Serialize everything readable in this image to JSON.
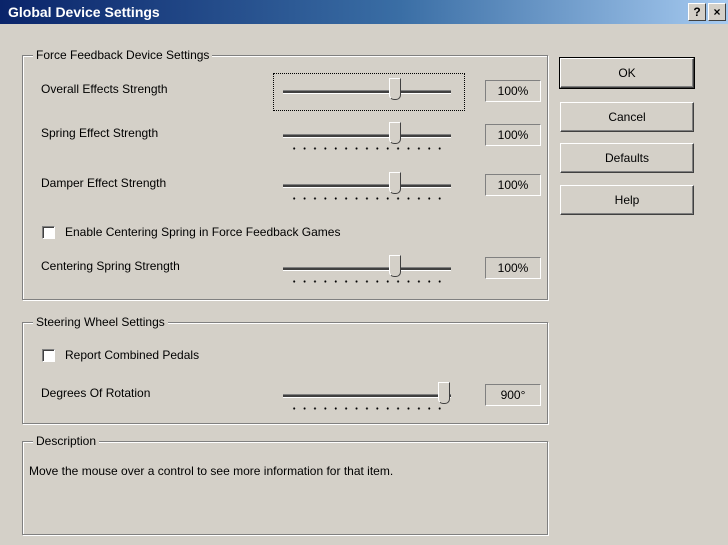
{
  "window": {
    "title": "Global Device Settings",
    "help_button": "?",
    "close_button": "×"
  },
  "force_feedback": {
    "legend": "Force Feedback Device Settings",
    "overall": {
      "label": "Overall Effects Strength",
      "value": "100%",
      "level": 100
    },
    "spring": {
      "label": "Spring Effect Strength",
      "value": "100%",
      "level": 100
    },
    "damper": {
      "label": "Damper Effect Strength",
      "value": "100%",
      "level": 100
    },
    "centering_checkbox": {
      "label": "Enable Centering Spring in Force Feedback Games",
      "checked": false
    },
    "centering": {
      "label": "Centering Spring Strength",
      "value": "100%",
      "level": 100
    }
  },
  "steering": {
    "legend": "Steering Wheel Settings",
    "pedals_checkbox": {
      "label": "Report Combined Pedals",
      "checked": false
    },
    "rotation": {
      "label": "Degrees Of Rotation",
      "value": "900°",
      "level": 900
    }
  },
  "description": {
    "legend": "Description",
    "text": "Move the mouse over a control to see more information for that item."
  },
  "buttons": {
    "ok": "OK",
    "cancel": "Cancel",
    "defaults": "Defaults",
    "help": "Help"
  }
}
